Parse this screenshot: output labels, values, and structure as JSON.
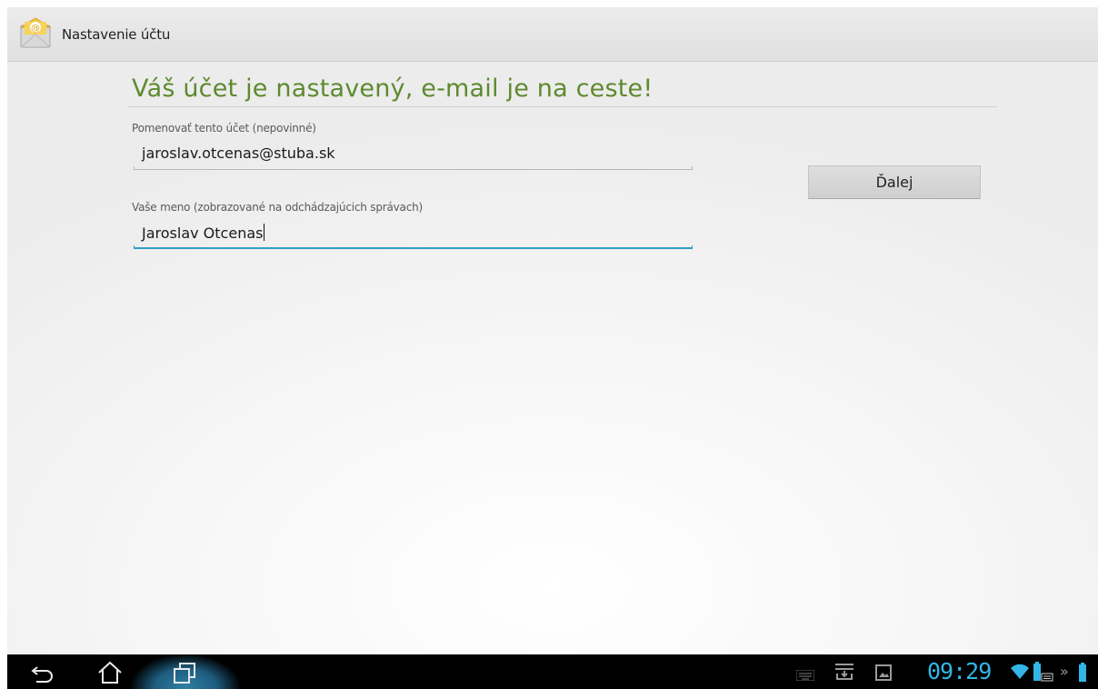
{
  "action_bar": {
    "title": "Nastavenie účtu",
    "icon": "email-app-icon"
  },
  "content": {
    "heading": "Váš účet je nastavený, e-mail je na ceste!",
    "account_name_label": "Pomenovať tento účet (nepovinné)",
    "account_name_value": "jaroslav.otcenas@stuba.sk",
    "your_name_label": "Vaše meno (zobrazované na odchádzajúcich správach)",
    "your_name_value": "Jaroslav Otcenas",
    "next_button": "Ďalej"
  },
  "system_bar": {
    "clock": "09:29",
    "icons": [
      "back-icon",
      "home-icon",
      "recent-apps-icon",
      "keyboard-icon",
      "download-icon",
      "gallery-icon",
      "wifi-icon",
      "battery-keyboard-icon",
      "expand-icon",
      "battery-icon"
    ]
  },
  "colors": {
    "heading": "#5e8a2f",
    "accent": "#33b5e5",
    "focus_underline": "#2e9fc7"
  }
}
